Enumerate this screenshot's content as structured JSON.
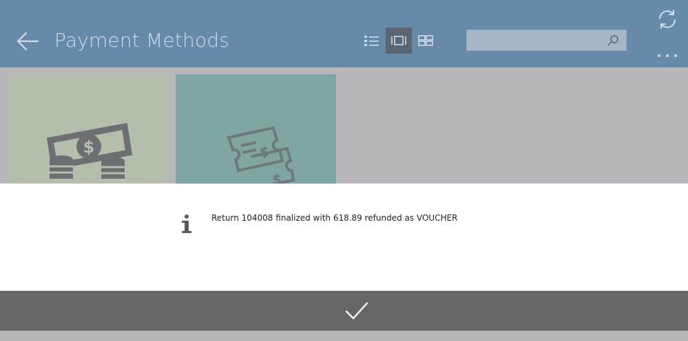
{
  "header": {
    "title": "Payment Methods",
    "back_icon": "arrow-left-icon",
    "view_modes": [
      {
        "name": "list-view",
        "icon": "list-icon",
        "active": false
      },
      {
        "name": "tile-view",
        "icon": "tile-icon",
        "active": true
      },
      {
        "name": "grid-view",
        "icon": "grid-icon",
        "active": false
      }
    ],
    "search": {
      "value": "",
      "placeholder": ""
    },
    "refresh_icon": "refresh-icon",
    "more_icon": "more-horizontal-icon"
  },
  "tiles": [
    {
      "name": "cash",
      "icon": "cash-icon",
      "color": "#b3bfaa"
    },
    {
      "name": "voucher",
      "icon": "voucher-icon",
      "color": "#80a6a2"
    }
  ],
  "dialog": {
    "icon": "info-icon",
    "message": "Return 104008 finalized with 618.89 refunded as VOUCHER"
  },
  "actions": {
    "ok_icon": "checkmark-icon"
  },
  "colors": {
    "header": "#688aa9",
    "overlay": "#b8b7b9",
    "action_bar": "#666568",
    "dialog": "#ffffff"
  }
}
